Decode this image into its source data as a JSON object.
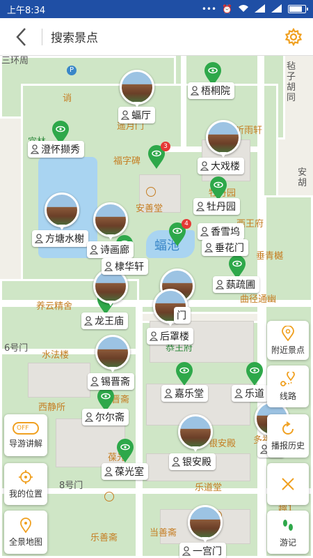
{
  "status_bar": {
    "time": "上午8:34"
  },
  "header": {
    "back_label": "<",
    "search_label": "搜索景点"
  },
  "colors": {
    "accent": "#f0a020",
    "pin_green": "#2ea84a",
    "status_blue": "#1f4fa5"
  },
  "map": {
    "labels": {
      "l1": "三环周",
      "l2": "宜林",
      "l3": "诮",
      "l4": "遥月门",
      "l5": "听雨轩",
      "l6": "福字碑",
      "l7": "安善堂",
      "l8": "蝠池",
      "l9": "牡丹园",
      "l10": "西王府",
      "l11": "垂青樾",
      "l12": "养云精舍",
      "l13": "曲径通幽",
      "l14": "6号门",
      "l15": "水法楼",
      "l16": "恭王府",
      "l17": "晋斋",
      "l18": "西静所",
      "l19": "银安殿",
      "l20": "葆光",
      "l21": "8号门",
      "l22": "乐道堂",
      "l23": "乐善斋",
      "l24": "当善斋",
      "l25": "毡子胡同",
      "l26": "安胡",
      "l27": "多福",
      "l28": "趣1"
    },
    "poi": {
      "p1": "梧桐院",
      "p2": "蝠厅",
      "p3": "澄怀撷秀",
      "p4": "大戏楼",
      "p5": "牡丹园",
      "p6": "方塘水榭",
      "p7": "香雪坞",
      "p8": "诗画廊",
      "p9": "垂花门",
      "p10": "棣华轩",
      "p11": "蓺疏圃",
      "p12": "龙王庙",
      "p13": "后罩楼",
      "p14": "锡晋斋",
      "p15": "嘉乐堂",
      "p16": "乐道",
      "p17": "尔尔斋",
      "p18": "银安殿",
      "p19": "葆光室",
      "p20": "一宫门",
      "p21": "门",
      "p22": "多"
    },
    "badges": {
      "b1": "3",
      "b2": "4"
    }
  },
  "buttons": {
    "nearby": "附近景点",
    "route": "线路",
    "history": "播报历史",
    "close": "",
    "footprint": "游记",
    "guide": "导游讲解",
    "guide_toggle": "OFF",
    "my_location": "我的位置",
    "full_map": "全景地图"
  }
}
